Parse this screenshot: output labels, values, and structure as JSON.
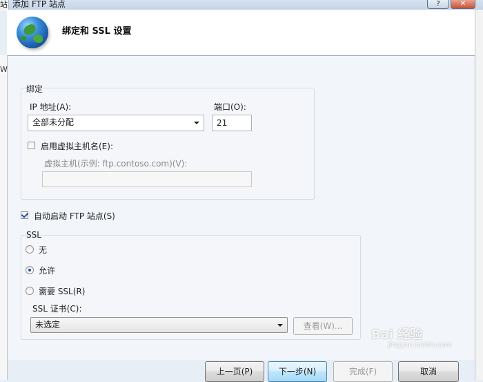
{
  "window": {
    "title": "添加 FTP 站点",
    "left_fragment": "站",
    "help_button": "?",
    "close_button": "✕"
  },
  "header": {
    "title": "绑定和 SSL 设置"
  },
  "side": {
    "left_letter": "W"
  },
  "binding": {
    "group_label": "绑定",
    "ip_label": "IP 地址(A):",
    "ip_value": "全部未分配",
    "port_label": "端口(O):",
    "port_value": "21",
    "virtual_host_checkbox_label": "启用虚拟主机名(E):",
    "virtual_host_checked": false,
    "virtual_host_label": "虚拟主机(示例: ftp.contoso.com)(V):",
    "virtual_host_value": ""
  },
  "autostart": {
    "label": "自动启动 FTP 站点(S)",
    "checked": true
  },
  "ssl": {
    "group_label": "SSL",
    "options": [
      {
        "label": "无",
        "selected": false
      },
      {
        "label": "允许",
        "selected": true
      },
      {
        "label": "需要 SSL(R)",
        "selected": false
      }
    ],
    "cert_label": "SSL 证书(C):",
    "cert_value": "未选定",
    "view_button": "查看(W)..."
  },
  "footer": {
    "prev_button": "上一页(P)",
    "next_button": "下一步(N)",
    "finish_button": "完成(F)",
    "cancel_button": "取消"
  },
  "watermark": {
    "text": "Bai 经验",
    "sub": "jingyan.baidu.com"
  }
}
